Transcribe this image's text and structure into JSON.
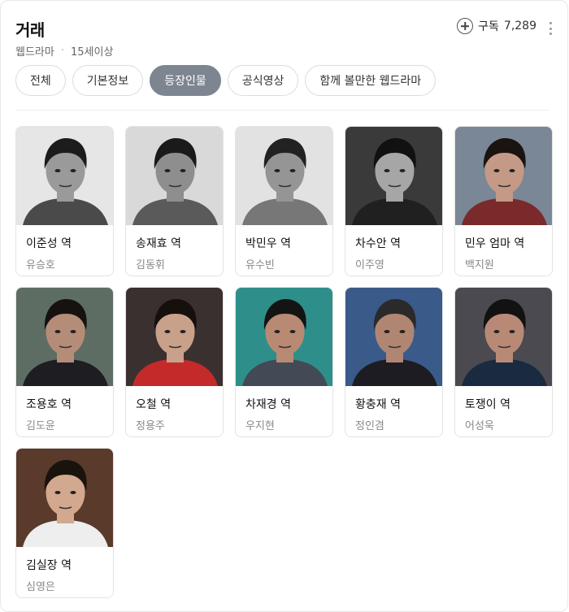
{
  "header": {
    "title": "거래",
    "genre": "웹드라마",
    "rating": "15세이상",
    "subscribe_label": "구독",
    "subscribe_count": "7,289"
  },
  "tabs": [
    {
      "label": "전체",
      "active": false
    },
    {
      "label": "기본정보",
      "active": false
    },
    {
      "label": "등장인물",
      "active": true
    },
    {
      "label": "공식영상",
      "active": false
    },
    {
      "label": "함께 볼만한 웹드라마",
      "active": false
    }
  ],
  "cast": [
    {
      "role": "이준성 역",
      "actor": "유승호",
      "photo": {
        "bg": "#e6e6e6",
        "skin": "#9a9a9a",
        "hair": "#1c1c1c",
        "cloth": "#4a4a4a"
      }
    },
    {
      "role": "송재효 역",
      "actor": "김동휘",
      "photo": {
        "bg": "#d9d9d9",
        "skin": "#8e8e8e",
        "hair": "#1a1a1a",
        "cloth": "#5a5a5a"
      }
    },
    {
      "role": "박민우 역",
      "actor": "유수빈",
      "photo": {
        "bg": "#e2e2e2",
        "skin": "#959595",
        "hair": "#222222",
        "cloth": "#777777"
      }
    },
    {
      "role": "차수안 역",
      "actor": "이주영",
      "photo": {
        "bg": "#3a3a3a",
        "skin": "#a6a6a6",
        "hair": "#111111",
        "cloth": "#202020"
      }
    },
    {
      "role": "민우 엄마 역",
      "actor": "백지원",
      "photo": {
        "bg": "#7a8796",
        "skin": "#c49a86",
        "hair": "#1a1410",
        "cloth": "#7a2a2a"
      }
    },
    {
      "role": "조용호 역",
      "actor": "김도윤",
      "photo": {
        "bg": "#5d6d63",
        "skin": "#b58c78",
        "hair": "#16120f",
        "cloth": "#1e1e22"
      }
    },
    {
      "role": "오철 역",
      "actor": "정용주",
      "photo": {
        "bg": "#3a3030",
        "skin": "#c9a08a",
        "hair": "#16100c",
        "cloth": "#c42a2a"
      }
    },
    {
      "role": "차재경 역",
      "actor": "우지현",
      "photo": {
        "bg": "#2e8f8a",
        "skin": "#b88a74",
        "hair": "#141414",
        "cloth": "#444a55"
      }
    },
    {
      "role": "황충재 역",
      "actor": "정인겸",
      "photo": {
        "bg": "#3a5a8a",
        "skin": "#b08672",
        "hair": "#2a2a2a",
        "cloth": "#1c1c22"
      }
    },
    {
      "role": "토쟁이 역",
      "actor": "어성욱",
      "photo": {
        "bg": "#4a4a50",
        "skin": "#b88a76",
        "hair": "#121212",
        "cloth": "#1a2a40"
      }
    },
    {
      "role": "김실장 역",
      "actor": "심영은",
      "photo": {
        "bg": "#5a3a2a",
        "skin": "#d2a88e",
        "hair": "#1a120c",
        "cloth": "#eeeeee"
      }
    }
  ]
}
